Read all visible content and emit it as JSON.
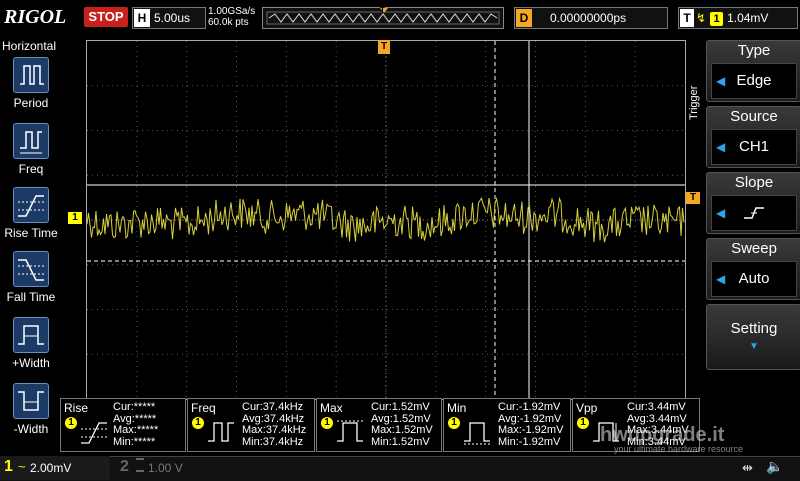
{
  "header": {
    "brand": "RIGOL",
    "run_state": "STOP",
    "timebase_label": "H",
    "timebase_value": "5.00us",
    "sample_rate": "1.00GSa/s",
    "memory_depth": "60.0k pts",
    "trigger_pos_marker": "T",
    "delay_label": "D",
    "delay_value": "0.00000000ps",
    "trigger_label": "T",
    "trigger_edge_symbol": "↯",
    "trigger_channel": "1",
    "trigger_level": "1.04mV"
  },
  "left_menu": {
    "title": "Horizontal",
    "items": [
      {
        "label": "Period",
        "icon": "period-icon"
      },
      {
        "label": "Freq",
        "icon": "freq-icon"
      },
      {
        "label": "Rise Time",
        "icon": "rise-time-icon"
      },
      {
        "label": "Fall Time",
        "icon": "fall-time-icon"
      },
      {
        "label": "+Width",
        "icon": "pos-width-icon"
      },
      {
        "label": "-Width",
        "icon": "neg-width-icon"
      }
    ]
  },
  "right_menu": {
    "tab": "Trigger",
    "type_label": "Type",
    "type_value": "Edge",
    "source_label": "Source",
    "source_value": "CH1",
    "slope_label": "Slope",
    "sweep_label": "Sweep",
    "sweep_value": "Auto",
    "setting_label": "Setting"
  },
  "markers": {
    "ch1_marker": "1",
    "trigger_level_marker": "T",
    "top_marker": "T"
  },
  "measurements": [
    {
      "name": "Rise",
      "ch": "1",
      "lines": [
        "Cur:*****",
        "Avg:*****",
        "Max:*****",
        "Min:*****"
      ]
    },
    {
      "name": "Freq",
      "ch": "1",
      "lines": [
        "Cur:37.4kHz",
        "Avg:37.4kHz",
        "Max:37.4kHz",
        "Min:37.4kHz"
      ]
    },
    {
      "name": "Max",
      "ch": "1",
      "lines": [
        "Cur:1.52mV",
        "Avg:1.52mV",
        "Max:1.52mV",
        "Min:1.52mV"
      ]
    },
    {
      "name": "Min",
      "ch": "1",
      "lines": [
        "Cur:-1.92mV",
        "Avg:-1.92mV",
        "Max:-1.92mV",
        "Min:-1.92mV"
      ]
    },
    {
      "name": "Vpp",
      "ch": "1",
      "lines": [
        "Cur:3.44mV",
        "Avg:3.44mV",
        "Max:3.44mV",
        "Min:3.44mV"
      ]
    }
  ],
  "footer": {
    "ch1_num": "1",
    "ch1_coupling": "~",
    "ch1_scale": "2.00mV",
    "ch2_num": "2",
    "ch2_scale": "1.00 V",
    "watermark": "hwupgrade.it",
    "watermark_sub": "your ultimate hardware resource"
  },
  "colors": {
    "ch1": "#ffff00",
    "trigger": "#f5a623",
    "stop": "#c8201f",
    "accent_blue": "#2aa6e8"
  }
}
